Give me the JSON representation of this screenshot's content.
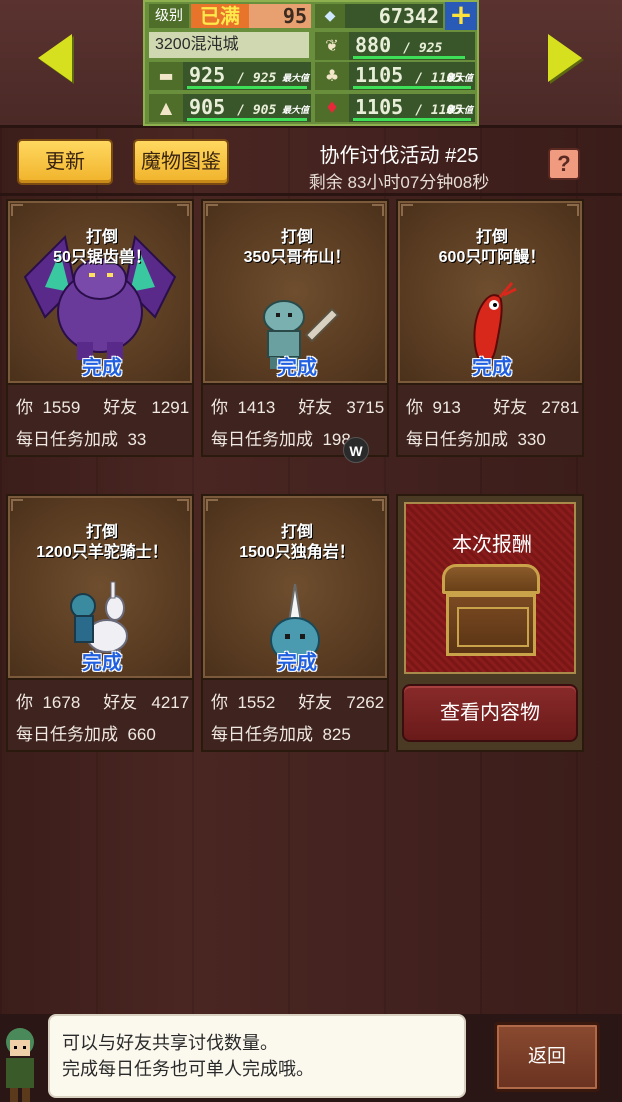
{
  "status": {
    "level_label": "级别",
    "level_max": "已满",
    "level_value": "95",
    "gems": "67342",
    "town": "3200混沌城",
    "resources": [
      {
        "icon": "grass-icon",
        "value": "880",
        "max": "925",
        "show_max_tag": false
      },
      {
        "icon": "wood-icon",
        "value": "925",
        "max": "925",
        "max_tag": "最大值"
      },
      {
        "icon": "food-icon",
        "value": "1105",
        "max": "1105",
        "max_tag": "最大值"
      },
      {
        "icon": "stone-icon",
        "value": "905",
        "max": "905",
        "max_tag": "最大值"
      },
      {
        "icon": "ruby-icon",
        "value": "1105",
        "max": "1105",
        "max_tag": "最大值"
      }
    ]
  },
  "toolbar": {
    "refresh_label": "更新",
    "bestiary_label": "魔物图鉴",
    "help_label": "?"
  },
  "event": {
    "title": "协作讨伐活动 #25",
    "remaining": "剩余 83小时07分钟08秒"
  },
  "cards": [
    {
      "verb": "打倒",
      "target": "50只锯齿兽！",
      "status": "完成",
      "you_label": "你",
      "you": "1559",
      "friend_label": "好友",
      "friend": "1291",
      "bonus_label": "每日任务加成",
      "bonus": "33",
      "monster": "purple-dragon",
      "color": "#6a3a9a"
    },
    {
      "verb": "打倒",
      "target": "350只哥布山！",
      "status": "完成",
      "you_label": "你",
      "you": "1413",
      "friend_label": "好友",
      "friend": "3715",
      "bonus_label": "每日任务加成",
      "bonus": "198",
      "monster": "goblin",
      "color": "#6aa0a0"
    },
    {
      "verb": "打倒",
      "target": "600只叮阿鳗！",
      "status": "完成",
      "you_label": "你",
      "you": "913",
      "friend_label": "好友",
      "friend": "2781",
      "bonus_label": "每日任务加成",
      "bonus": "330",
      "monster": "red-eel",
      "color": "#d8281c"
    },
    {
      "verb": "打倒",
      "target": "1200只羊驼骑士！",
      "status": "完成",
      "you_label": "你",
      "you": "1678",
      "friend_label": "好友",
      "friend": "4217",
      "bonus_label": "每日任务加成",
      "bonus": "660",
      "monster": "alpaca-knight",
      "color": "#e8e8f0"
    },
    {
      "verb": "打倒",
      "target": "1500只独角岩！",
      "status": "完成",
      "you_label": "你",
      "you": "1552",
      "friend_label": "好友",
      "friend": "7262",
      "bonus_label": "每日任务加成",
      "bonus": "825",
      "monster": "horn-rock",
      "color": "#4a9ab0"
    }
  ],
  "reward": {
    "title": "本次报酬",
    "view_label": "查看内容物"
  },
  "overlay_badge": "W",
  "dialog": {
    "line1": "可以与好友共享讨伐数量。",
    "line2": "完成每日任务也可单人完成哦。"
  },
  "back_label": "返回"
}
